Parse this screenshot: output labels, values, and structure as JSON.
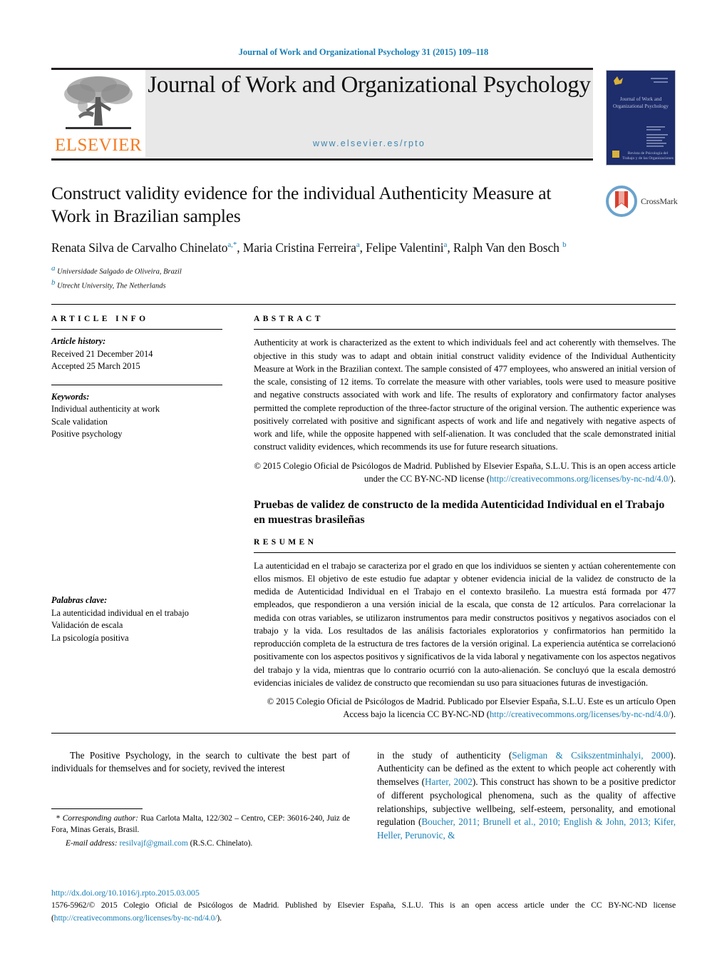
{
  "running_head": "Journal of Work and Organizational Psychology 31 (2015) 109–118",
  "banner": {
    "publisher": "ELSEVIER",
    "journal_title": "Journal of Work and Organizational Psychology",
    "url": "www.elsevier.es/rpto",
    "cover_lines": [
      "Journal of Work and",
      "Organizational Psychology"
    ],
    "cover_footer": [
      "Revista de Psicología del",
      "Trabajo y de las Organizaciones"
    ]
  },
  "article": {
    "title": "Construct validity evidence for the individual Authenticity Measure at Work in Brazilian samples",
    "crossmark_label": "CrossMark",
    "authors_html": "Renata Silva de Carvalho Chinelato<sup>a,</sup><sup class=\"star\">*</sup>,  Maria Cristina Ferreira<sup>a</sup>,  Felipe Valentini<sup>a</sup>, Ralph Van den Bosch <sup>b</sup>",
    "affiliations": [
      {
        "marker": "a",
        "text": "Universidade Salgado de Oliveira, Brazil"
      },
      {
        "marker": "b",
        "text": "Utrecht University, The Netherlands"
      }
    ]
  },
  "article_info": {
    "heading": "ARTICLE INFO",
    "history_label": "Article history:",
    "history_lines": [
      "Received 21 December 2014",
      "Accepted 25 March 2015"
    ],
    "keywords_label": "Keywords:",
    "keywords": [
      "Individual authenticity at work",
      "Scale validation",
      "Positive psychology"
    ],
    "palabras_label": "Palabras clave:",
    "palabras": [
      "La autenticidad individual en el trabajo",
      "Validación de escala",
      "La psicología positiva"
    ]
  },
  "abstract": {
    "heading": "ABSTRACT",
    "text": "Authenticity at work is characterized as the extent to which individuals feel and act coherently with themselves. The objective in this study was to adapt and obtain initial construct validity evidence of the Individual Authenticity Measure at Work in the Brazilian context. The sample consisted of 477 employees, who answered an initial version of the scale, consisting of 12 items. To correlate the measure with other variables, tools were used to measure positive and negative constructs associated with work and life. The results of exploratory and confirmatory factor analyses permitted the complete reproduction of the three-factor structure of the original version. The authentic experience was positively correlated with positive and significant aspects of work and life and negatively with negative aspects of work and life, while the opposite happened with self-alienation. It was concluded that the scale demonstrated initial construct validity evidences, which recommends its use for future research situations.",
    "copyright_prefix": "© 2015 Colegio Oficial de Psicólogos de Madrid. Published by Elsevier España, S.L.U. This is an open access article under the CC BY-NC-ND license (",
    "copyright_link": "http://creativecommons.org/licenses/by-nc-nd/4.0/",
    "copyright_suffix": ")."
  },
  "resumen": {
    "spanish_title": "Pruebas de validez de constructo de la medida Autenticidad Individual en el Trabajo en muestras brasileñas",
    "heading": "RESUMEN",
    "text": "La autenticidad en el trabajo se caracteriza por el grado en que los individuos se sienten y actúan coherentemente con ellos mismos. El objetivo de este estudio fue adaptar y obtener evidencia inicial de la validez de constructo de la medida de Autenticidad Individual en el Trabajo en el contexto brasileño. La muestra está formada por 477 empleados, que respondieron a una versión inicial de la escala, que consta de 12 artículos. Para correlacionar la medida con otras variables, se utilizaron instrumentos para medir constructos positivos y negativos asociados con el trabajo y la vida. Los resultados de las análisis factoriales exploratorios y confirmatorios han permitido la reproducción completa de la estructura de tres factores de la versión original. La experiencia auténtica se correlacionó positivamente con los aspectos positivos y significativos de la vida laboral y negativamente con los aspectos negativos del trabajo y la vida, mientras que lo contrario ocurrió con la auto-alienación. Se concluyó que la escala demostró evidencias iniciales de validez de constructo que recomiendan su uso para situaciones futuras de investigación.",
    "copyright_prefix": "© 2015 Colegio Oficial de Psicólogos de Madrid. Publicado por Elsevier España, S.L.U. Este es un artículo Open Access bajo la licencia CC BY-NC-ND (",
    "copyright_link": "http://creativecommons.org/licenses/by-nc-nd/4.0/",
    "copyright_suffix": ")."
  },
  "body": {
    "left_paragraph": "The Positive Psychology, in the search to cultivate the best part of individuals for themselves and for society, revived the interest",
    "right_paragraph_parts": [
      {
        "type": "text",
        "value": "in the study of authenticity ("
      },
      {
        "type": "link",
        "value": "Seligman & Csikszentminhalyi, 2000"
      },
      {
        "type": "text",
        "value": "). Authenticity can be defined as the extent to which people act coherently with themselves ("
      },
      {
        "type": "link",
        "value": "Harter, 2002"
      },
      {
        "type": "text",
        "value": "). This construct has shown to be a positive predictor of different psychological phenomena, such as the quality of affective relationships, subjective wellbeing, self-esteem, personality, and emotional regulation ("
      },
      {
        "type": "link",
        "value": "Boucher, 2011; Brunell et al., 2010; English & John, 2013; Kifer, Heller, Perunovic, &"
      }
    ]
  },
  "footnote": {
    "star": "*",
    "corresponding_label": "Corresponding author:",
    "address": "Rua Carlota Malta, 122/302 – Centro, CEP: 36016-240, Juiz de Fora, Minas Gerais, Brasil.",
    "email_label": "E-mail address:",
    "email": "resilvajf@gmail.com",
    "email_suffix": "(R.S.C. Chinelato)."
  },
  "bottom": {
    "doi": "http://dx.doi.org/10.1016/j.rpto.2015.03.005",
    "issn_prefix": "1576-5962/© 2015 Colegio Oficial de Psicólogos de Madrid. Published by Elsevier España, S.L.U. This is an open access article under the CC BY-NC-ND license (",
    "issn_link": "http://creativecommons.org/licenses/by-nc-nd/4.0/",
    "issn_suffix": ")."
  },
  "colors": {
    "link": "#1a7fb5",
    "elsevier_orange": "#f47b20",
    "banner_gray": "#e8e8e8",
    "cover_navy": "#1e2d6b"
  }
}
